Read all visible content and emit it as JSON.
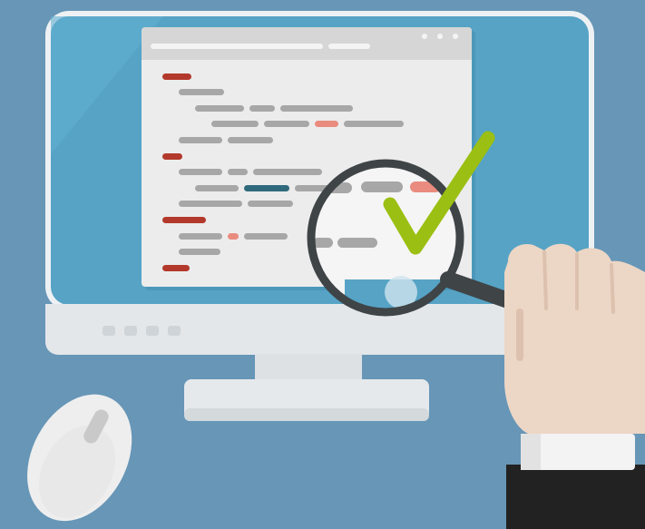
{
  "scene": {
    "subject": "code-review-illustration",
    "colors": {
      "background": "#6796b7",
      "screen": "#56a3c5",
      "monitor_frame": "#eef1f3",
      "monitor_chin": "#e3e7ea",
      "browser_window": "#ececec",
      "browser_titlebar": "#cfcfcf",
      "code_gray": "#a7a7a7",
      "code_red": "#b3392c",
      "code_salmon": "#e98b7e",
      "code_teal": "#2f6a7c",
      "magnifier_ring": "#3f4447",
      "checkmark": "#9bbf12",
      "skin": "#ecd6c5",
      "sleeve": "#f3f3f3",
      "jacket": "#222222",
      "mouse": "#eeeeee"
    },
    "icons": [
      "code-window",
      "magnifying-glass-icon",
      "checkmark-icon",
      "computer-mouse-icon",
      "hand-icon"
    ]
  }
}
